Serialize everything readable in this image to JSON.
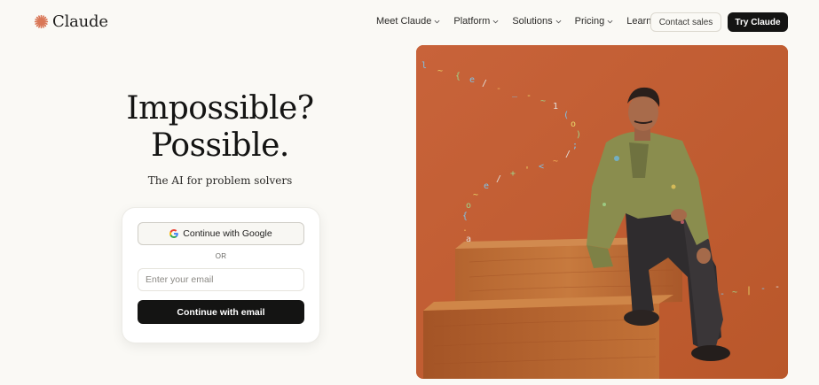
{
  "brand": {
    "name": "Claude",
    "accent": "#d97757"
  },
  "nav": {
    "items": [
      {
        "label": "Meet Claude"
      },
      {
        "label": "Platform"
      },
      {
        "label": "Solutions"
      },
      {
        "label": "Pricing"
      },
      {
        "label": "Learn"
      }
    ],
    "contact_label": "Contact sales",
    "try_label": "Try Claude"
  },
  "hero": {
    "title_line1": "Impossible?",
    "title_line2": "Possible.",
    "subtitle": "The AI for problem solvers"
  },
  "login": {
    "google_label": "Continue with Google",
    "divider": "OR",
    "email_placeholder": "Enter your email",
    "email_button": "Continue with email"
  },
  "colors": {
    "background": "#faf9f5",
    "primary_button": "#141413",
    "image_backdrop": "#c4602f"
  },
  "icons": [
    "claude-starburst-icon",
    "chevron-down-icon",
    "google-g-icon"
  ]
}
